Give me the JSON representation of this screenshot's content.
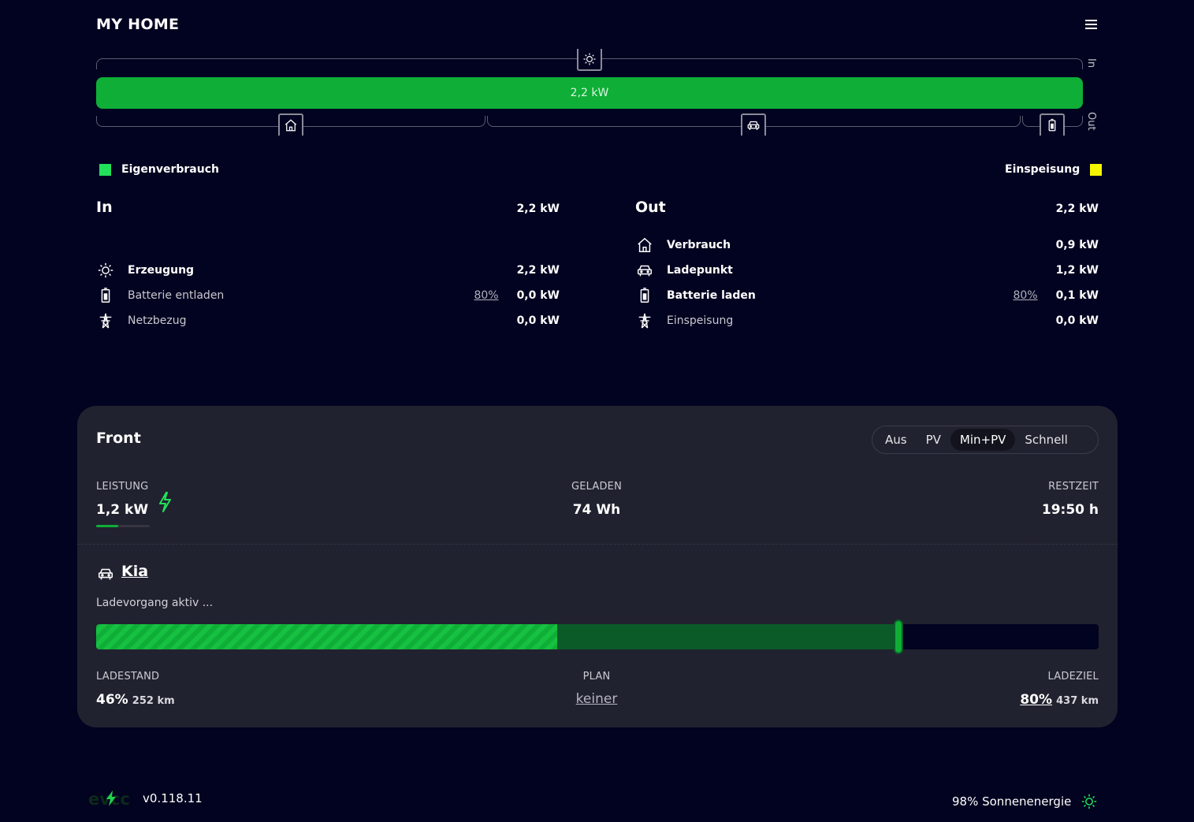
{
  "header": {
    "title": "MY HOME"
  },
  "flow": {
    "bar_value": "2,2 kW",
    "label_in": "In",
    "label_out": "Out",
    "colors": {
      "self_consumption": "#0fae37",
      "feed_in": "#f5f500"
    }
  },
  "legend": {
    "self_consumption": "Eigenverbrauch",
    "feed_in": "Einspeisung"
  },
  "in": {
    "title": "In",
    "total": "2,2 kW",
    "rows": [
      {
        "icon": "sun-icon",
        "label": "Erzeugung",
        "soc": "",
        "value": "2,2 kW"
      },
      {
        "icon": "battery-icon",
        "label": "Batterie entladen",
        "soc": "80%",
        "value": "0,0 kW"
      },
      {
        "icon": "grid-tower-icon",
        "label": "Netzbezug",
        "soc": "",
        "value": "0,0 kW"
      }
    ]
  },
  "out": {
    "title": "Out",
    "total": "2,2 kW",
    "rows": [
      {
        "icon": "home-icon",
        "label": "Verbrauch",
        "soc": "",
        "value": "0,9 kW"
      },
      {
        "icon": "car-icon",
        "label": "Ladepunkt",
        "soc": "",
        "value": "1,2 kW"
      },
      {
        "icon": "battery-icon",
        "label": "Batterie laden",
        "soc": "80%",
        "value": "0,1 kW"
      },
      {
        "icon": "grid-tower-icon",
        "label": "Einspeisung",
        "soc": "",
        "value": "0,0 kW"
      }
    ]
  },
  "loadpoint": {
    "title": "Front",
    "modes": [
      "Aus",
      "PV",
      "Min+PV",
      "Schnell"
    ],
    "active_mode": "Min+PV",
    "power_label": "LEISTUNG",
    "power_value": "1,2 kW",
    "charged_label": "GELADEN",
    "charged_value": "74 Wh",
    "remaining_label": "RESTZEIT",
    "remaining_value": "19:50 h",
    "vehicle": {
      "name": "Kia",
      "status": "Ladevorgang aktiv ...",
      "soc_percent": 46,
      "target_percent": 80,
      "soc_label": "LADESTAND",
      "soc_value": "46%",
      "soc_range": "252 km",
      "plan_label": "PLAN",
      "plan_value": "keiner",
      "target_label": "LADEZIEL",
      "target_value": "80%",
      "target_range": "437 km"
    }
  },
  "footer": {
    "logo_text": "evcc",
    "version": "v0.118.11",
    "solar_share": "98% Sonnenenergie"
  }
}
